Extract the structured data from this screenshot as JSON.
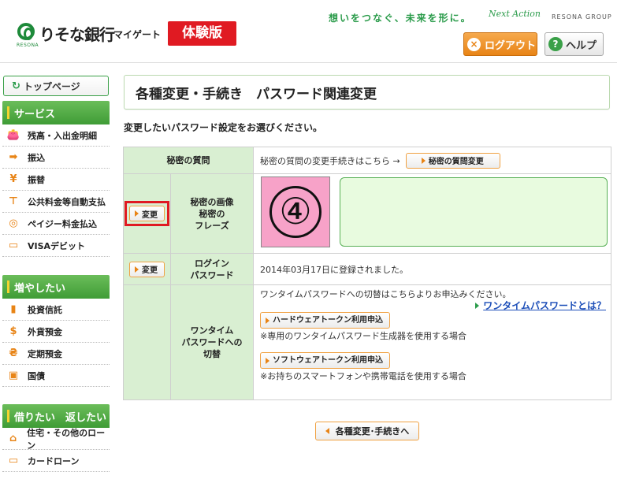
{
  "header": {
    "bank_name": "りそな銀行",
    "mygate": "マイゲート",
    "logo_sub": "RESONA",
    "trial_badge": "体験版",
    "slogan": "想いをつなぐ、未来を形に。",
    "next_action": "Next Action",
    "group_name": "RESONA GROUP",
    "logout_label": "ログアウト",
    "help_label": "ヘルプ"
  },
  "sidebar": {
    "top_page": "トップページ",
    "groups": [
      {
        "title": "サービス",
        "items": [
          {
            "label": "残高・入出金明細",
            "icon": "wallet-icon"
          },
          {
            "label": "振込",
            "icon": "transfer-icon"
          },
          {
            "label": "振替",
            "icon": "yen-exchange-icon"
          },
          {
            "label": "公共料金等自動支払",
            "icon": "faucet-icon"
          },
          {
            "label": "ペイジー料金払込",
            "icon": "payeasy-icon"
          },
          {
            "label": "VISAデビット",
            "icon": "debit-card-icon"
          }
        ]
      },
      {
        "title": "増やしたい",
        "items": [
          {
            "label": "投資信託",
            "icon": "chart-icon"
          },
          {
            "label": "外貨預金",
            "icon": "dollar-icon"
          },
          {
            "label": "定期預金",
            "icon": "money-bag-icon"
          },
          {
            "label": "国債",
            "icon": "bond-icon"
          }
        ]
      },
      {
        "title": "借りたい　返したい",
        "items": [
          {
            "label": "住宅・その他のローン",
            "icon": "house-icon"
          },
          {
            "label": "カードローン",
            "icon": "card-icon"
          }
        ]
      }
    ]
  },
  "main": {
    "title": "各種変更・手続き　パスワード関連変更",
    "instruction": "変更したいパスワード設定をお選びください。",
    "rows": {
      "secret_question": {
        "label": "秘密の質問",
        "text": "秘密の質問の変更手続きはこちら →",
        "button": "秘密の質問変更"
      },
      "secret_image": {
        "button": "変更",
        "label_line1": "秘密の画像",
        "label_line2": "秘密の",
        "label_line3": "フレーズ",
        "image_number": "④"
      },
      "login_password": {
        "button": "変更",
        "label_line1": "ログイン",
        "label_line2": "パスワード",
        "text": "2014年03月17日に登録されました。"
      },
      "onetime": {
        "label_line1": "ワンタイム",
        "label_line2": "パスワードへの",
        "label_line3": "切替",
        "intro": "ワンタイムパスワードへの切替はこちらよりお申込みください。",
        "link": "ワンタイムパスワードとは？",
        "hw_button": "ハードウェアトークン利用申込",
        "hw_note": "※専用のワンタイムパスワード生成器を使用する場合",
        "sw_button": "ソフトウェアトークン利用申込",
        "sw_note": "※お持ちのスマートフォンや携帯電話を使用する場合"
      }
    },
    "back_button": "各種変更･手続きへ"
  },
  "colors": {
    "brand_green": "#2a9b4a",
    "trial_red": "#e01a22",
    "logout_orange": "#e88416",
    "table_label_bg": "#d9efd2",
    "image_pink": "#f7a2c8"
  }
}
